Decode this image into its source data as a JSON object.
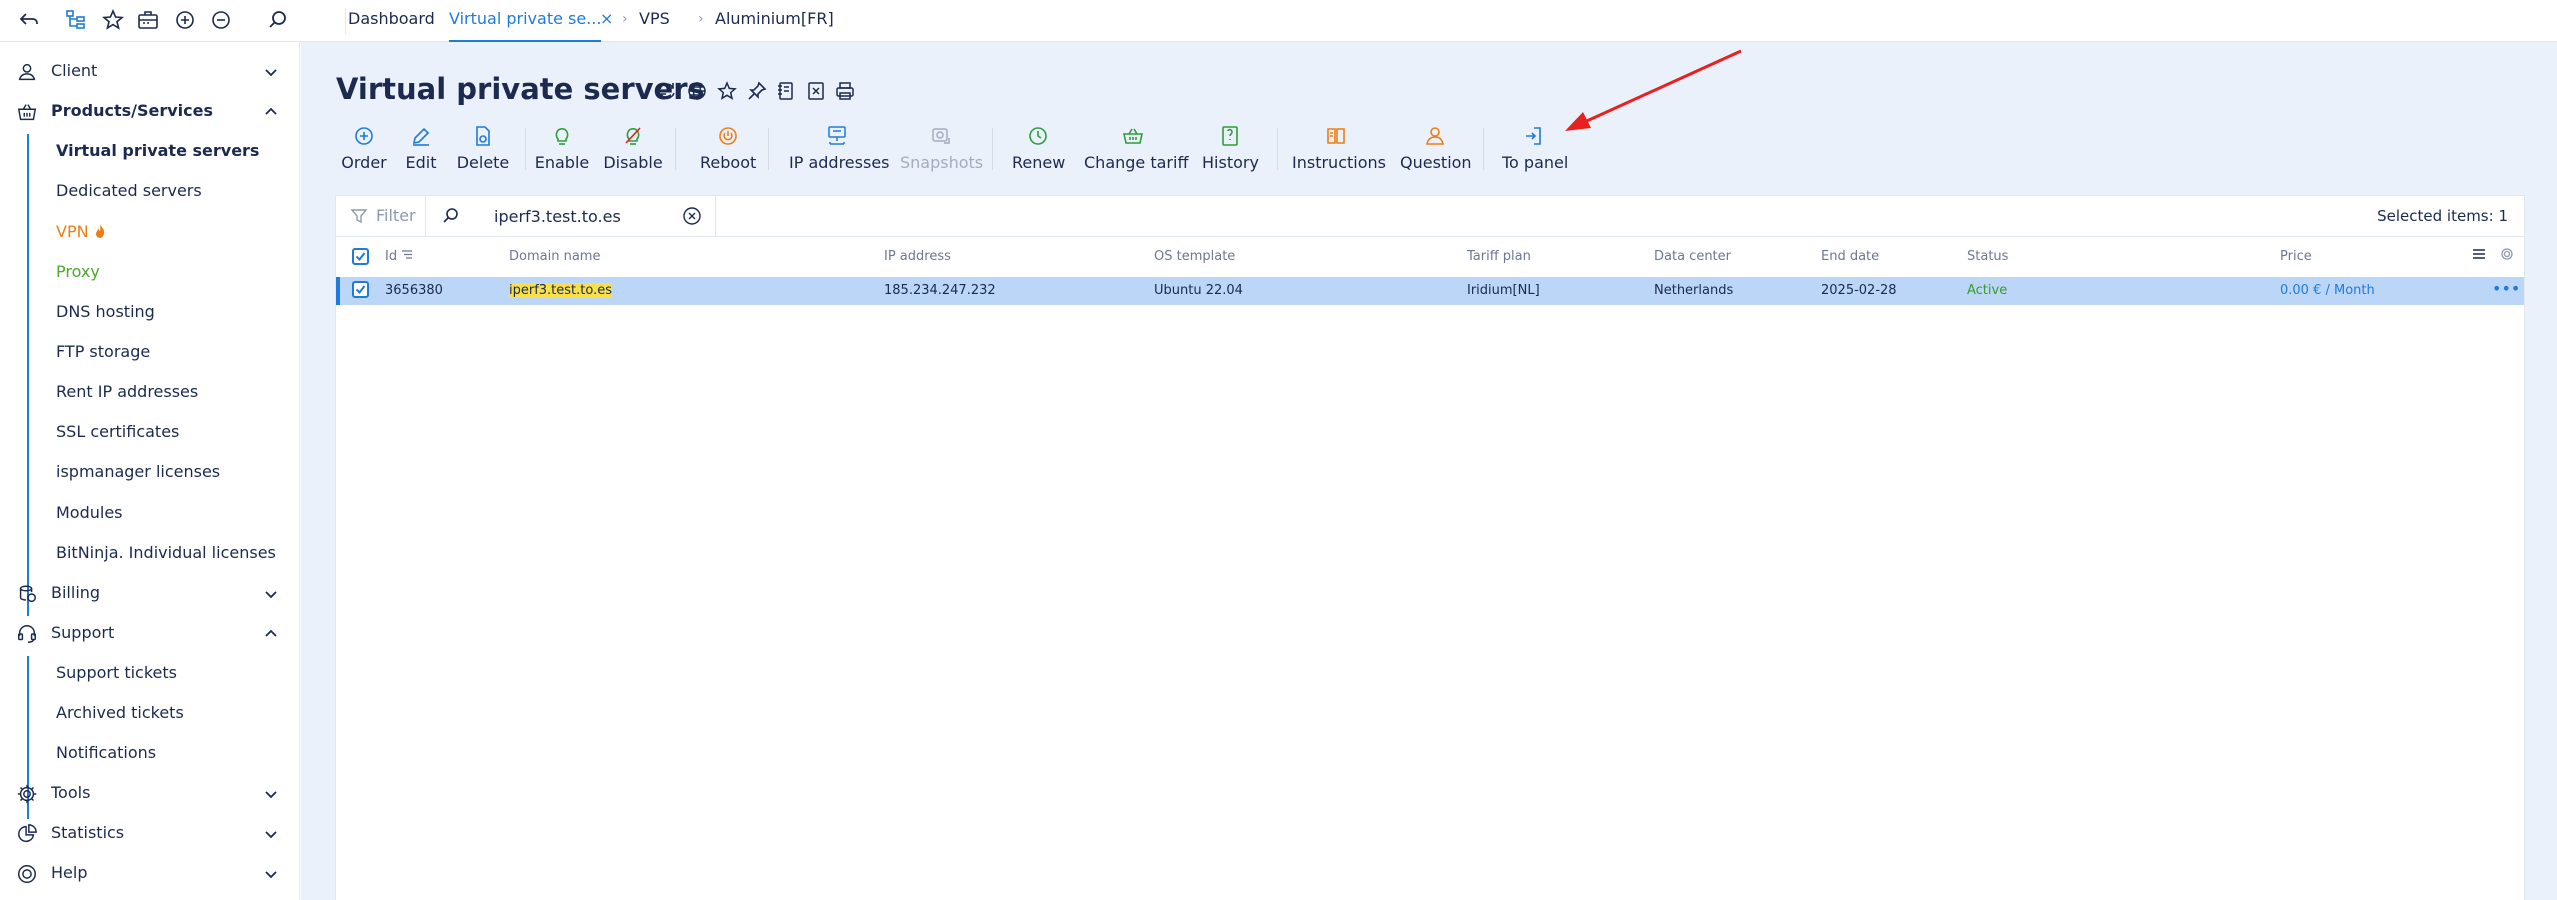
{
  "tabs": [
    {
      "label": "Dashboard"
    },
    {
      "label": "Virtual private se..."
    },
    {
      "label": "VPS"
    },
    {
      "label": "Aluminium[FR]"
    }
  ],
  "tab_close": "×",
  "crumb_sep": "›",
  "sidebar": {
    "groups": [
      {
        "label": "Client",
        "icon": "user-icon"
      },
      {
        "label": "Products/Services",
        "icon": "basket-icon"
      },
      {
        "label": "Billing",
        "icon": "coins-icon"
      },
      {
        "label": "Support",
        "icon": "headset-icon"
      },
      {
        "label": "Tools",
        "icon": "gear-icon"
      },
      {
        "label": "Statistics",
        "icon": "pie-chart-icon"
      },
      {
        "label": "Help",
        "icon": "lifebuoy-icon"
      }
    ],
    "products_items": [
      {
        "label": "Virtual private servers"
      },
      {
        "label": "Dedicated servers"
      },
      {
        "label": "VPN"
      },
      {
        "label": "Proxy"
      },
      {
        "label": "DNS hosting"
      },
      {
        "label": "FTP storage"
      },
      {
        "label": "Rent IP addresses"
      },
      {
        "label": "SSL certificates"
      },
      {
        "label": "ispmanager licenses"
      },
      {
        "label": "Modules"
      },
      {
        "label": "BitNinja. Individual licenses"
      }
    ],
    "support_items": [
      {
        "label": "Support tickets"
      },
      {
        "label": "Archived tickets"
      },
      {
        "label": "Notifications"
      }
    ]
  },
  "page": {
    "title": "Virtual private servers"
  },
  "toolbar": [
    {
      "label": "Order",
      "icon": "plus-circle-icon",
      "color": "#1f7bd8"
    },
    {
      "label": "Edit",
      "icon": "pencil-icon",
      "color": "#1f7bd8"
    },
    {
      "label": "Delete",
      "icon": "trash-icon",
      "color": "#1f7bd8"
    },
    {
      "label": "Enable",
      "icon": "bulb-on-icon",
      "color": "#2e9d3a"
    },
    {
      "label": "Disable",
      "icon": "bulb-off-icon",
      "color": "#2e9d3a"
    },
    {
      "label": "Reboot",
      "icon": "power-icon",
      "color": "#f07d12"
    },
    {
      "label": "IP addresses",
      "icon": "network-icon",
      "color": "#1f7bd8"
    },
    {
      "label": "Snapshots",
      "icon": "camera-icon",
      "color": "#a4adbc"
    },
    {
      "label": "Renew",
      "icon": "renew-clock-icon",
      "color": "#2e9d3a"
    },
    {
      "label": "Change tariff",
      "icon": "basket-icon",
      "color": "#2e9d3a"
    },
    {
      "label": "History",
      "icon": "history-icon",
      "color": "#2e9d3a"
    },
    {
      "label": "Instructions",
      "icon": "book-icon",
      "color": "#f07d12"
    },
    {
      "label": "Question",
      "icon": "question-user-icon",
      "color": "#f07d12"
    },
    {
      "label": "To panel",
      "icon": "login-icon",
      "color": "#1f7bd8"
    }
  ],
  "filter": {
    "label": "Filter",
    "search_value": "iperf3.test.to.es",
    "selected_label": "Selected items: 1"
  },
  "table": {
    "columns": [
      "Id",
      "Domain name",
      "IP address",
      "OS template",
      "Tariff plan",
      "Data center",
      "End date",
      "Status",
      "Price"
    ],
    "rows": [
      {
        "id": "3656380",
        "domain": "iperf3.test.to.es",
        "ip": "185.234.247.232",
        "os": "Ubuntu 22.04",
        "tariff": "Iridium[NL]",
        "datacenter": "Netherlands",
        "end_date": "2025-02-28",
        "status": "Active",
        "price": "0.00 € / Month",
        "selected": true
      }
    ]
  },
  "colors": {
    "accent": "#1f7bd8",
    "annotation": "#e8201e",
    "background": "#ebf1fb"
  }
}
